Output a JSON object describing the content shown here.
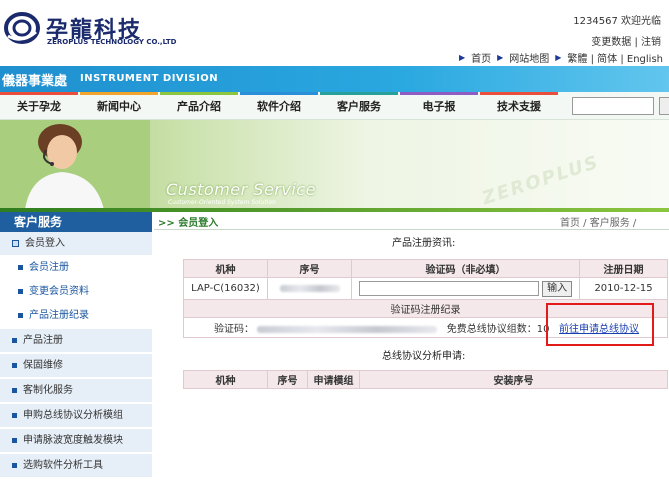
{
  "brand": {
    "name_cn": "孕龍科技",
    "name_en": "ZEROPLUS TECHNOLOGY CO.,LTD"
  },
  "user": {
    "welcome": "1234567 欢迎光临",
    "links": [
      "变更数据",
      "注销"
    ]
  },
  "top_nav": [
    "首页",
    "网站地图",
    "繁體",
    "简体",
    "English"
  ],
  "division": {
    "cn": "儀器事業處",
    "en": "INSTRUMENT DIVISION"
  },
  "menu": [
    {
      "label": "关于孕龙",
      "color": "#e94f3a"
    },
    {
      "label": "新闻中心",
      "color": "#f3a52b"
    },
    {
      "label": "产品介绍",
      "color": "#8cc63f"
    },
    {
      "label": "软件介绍",
      "color": "#2a8fd6"
    },
    {
      "label": "客户服务",
      "color": "#27a09a"
    },
    {
      "label": "电子报",
      "color": "#8e5cc2"
    },
    {
      "label": "技术支援",
      "color": "#e94f3a"
    }
  ],
  "hero": {
    "title": "Customer  Service",
    "subtitle": "Customer-Oriented System Solution",
    "watermark": "ZEROPLUS"
  },
  "sidebar": {
    "title": "客户服务",
    "items": [
      {
        "label": "会员登入",
        "type": "box"
      },
      {
        "label": "会员注册",
        "type": "sub"
      },
      {
        "label": "变更会员资料",
        "type": "sub"
      },
      {
        "label": "产品注册纪录",
        "type": "sub"
      },
      {
        "label": "产品注册",
        "type": "main"
      },
      {
        "label": "保固维修",
        "type": "main"
      },
      {
        "label": "客制化服务",
        "type": "main"
      },
      {
        "label": "申购总线协议分析模组",
        "type": "main"
      },
      {
        "label": "申请脉波宽度触发模块",
        "type": "main"
      },
      {
        "label": "选购软件分析工具",
        "type": "main"
      }
    ]
  },
  "page": {
    "heading": ">> 会员登入",
    "breadcrumb": "首页 / 客户服务 /"
  },
  "registration": {
    "section_title": "产品注册资讯:",
    "headers": [
      "机种",
      "序号",
      "验证码（非必填）",
      "注册日期"
    ],
    "row": {
      "model": "LAP-C(16032)",
      "date": "2010-12-15"
    },
    "input_button": "输入",
    "record_title": "验证码注册纪录",
    "code_label": "验证码：",
    "free_label": "免费总线协议组数：10",
    "apply_link": "前往申请总线协议"
  },
  "analysis": {
    "section_title": "总线协议分析申请:",
    "headers": [
      "机种",
      "序号",
      "申请模组",
      "安装序号"
    ]
  },
  "colors": {
    "accent_blue": "#1f5f9f",
    "highlight_red": "#e21a1a",
    "link_blue": "#1a3fb0"
  }
}
